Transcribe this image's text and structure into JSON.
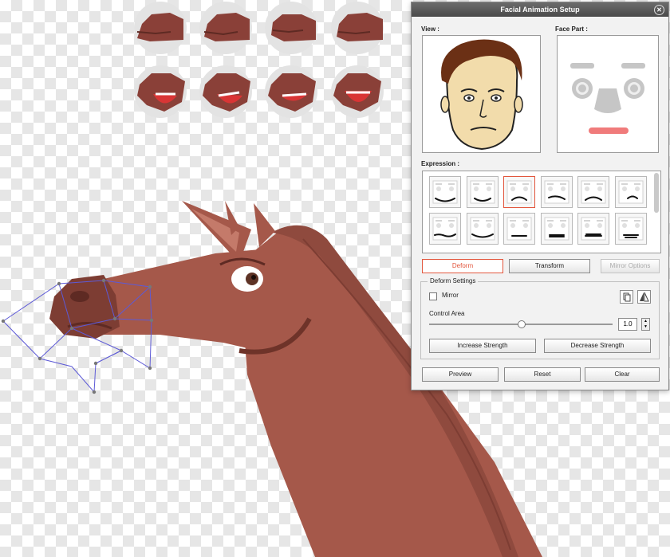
{
  "window": {
    "title": "Facial Animation Setup",
    "close_icon": "close-icon"
  },
  "view_label": "View :",
  "face_part_label": "Face Part :",
  "expression_label": "Expression :",
  "expressions_count": 12,
  "selected_expression_index": 2,
  "modes": {
    "deform": "Deform",
    "transform": "Transform",
    "mirror_options": "Mirror Options"
  },
  "deform_settings": {
    "title": "Deform Settings",
    "mirror_label": "Mirror",
    "mirror_checked": false,
    "control_area_label": "Control Area",
    "control_area_value": "1.0",
    "control_area_level": 0.5,
    "increase_label": "Increase Strength",
    "decrease_label": "Decrease Strength"
  },
  "footer": {
    "preview": "Preview",
    "reset": "Reset",
    "clear": "Clear"
  },
  "colors": {
    "accent": "#e2563d",
    "horse": "#a5584a",
    "horse_dark": "#7d3d33",
    "mouth_highlight": "#f07b7b"
  }
}
